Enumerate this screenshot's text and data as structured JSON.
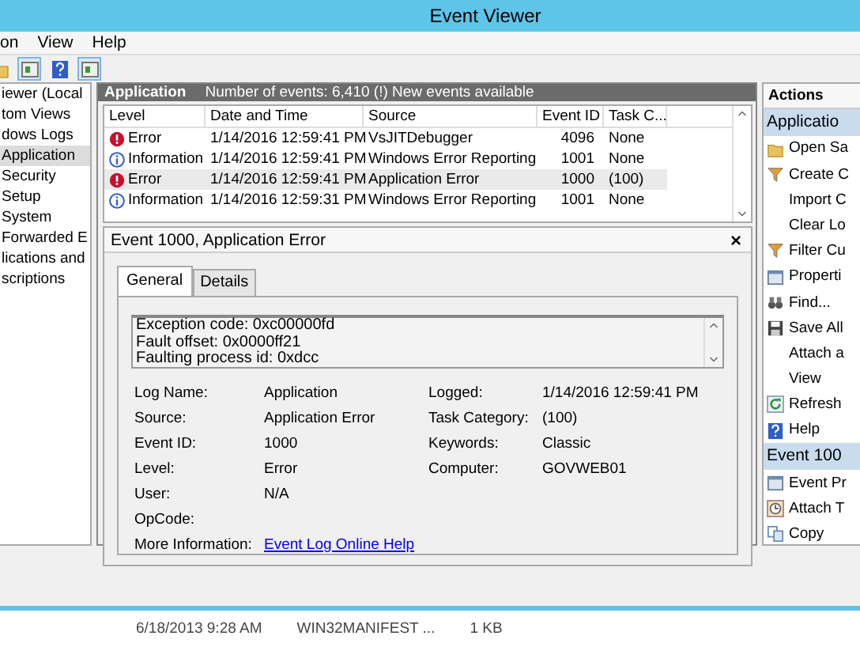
{
  "window": {
    "title": "Event Viewer"
  },
  "menu": [
    "on",
    "View",
    "Help"
  ],
  "toolbar": [
    {
      "kind": "folder",
      "selected": false
    },
    {
      "kind": "panel",
      "selected": true
    },
    {
      "kind": "help",
      "selected": false
    },
    {
      "kind": "panel",
      "selected": true
    }
  ],
  "tree": [
    {
      "label": "iewer (Local",
      "selected": false
    },
    {
      "label": "tom Views",
      "selected": false
    },
    {
      "label": "dows Logs",
      "selected": false
    },
    {
      "label": "Application",
      "selected": true
    },
    {
      "label": "Security",
      "selected": false
    },
    {
      "label": "Setup",
      "selected": false
    },
    {
      "label": "System",
      "selected": false
    },
    {
      "label": "Forwarded E",
      "selected": false
    },
    {
      "label": "lications and",
      "selected": false
    },
    {
      "label": "scriptions",
      "selected": false
    }
  ],
  "log_header": {
    "title": "Application",
    "summary": "Number of events: 6,410 (!) New events available"
  },
  "table": {
    "columns": [
      "Level",
      "Date and Time",
      "Source",
      "Event ID",
      "Task C..."
    ],
    "rows": [
      {
        "kind": "error",
        "selected": false,
        "cells": [
          "Error",
          "1/14/2016 12:59:41 PM",
          "VsJITDebugger",
          "4096",
          "None"
        ]
      },
      {
        "kind": "information",
        "selected": false,
        "cells": [
          "Information",
          "1/14/2016 12:59:41 PM",
          "Windows Error Reporting",
          "1001",
          "None"
        ]
      },
      {
        "kind": "error",
        "selected": true,
        "cells": [
          "Error",
          "1/14/2016 12:59:41 PM",
          "Application Error",
          "1000",
          "(100)"
        ]
      },
      {
        "kind": "information",
        "selected": false,
        "cells": [
          "Information",
          "1/14/2016 12:59:31 PM",
          "Windows Error Reporting",
          "1001",
          "None"
        ]
      }
    ]
  },
  "detail": {
    "title": "Event 1000, Application Error",
    "close": "×",
    "tabs": [
      {
        "label": "General",
        "selected": true
      },
      {
        "label": "Details",
        "selected": false
      }
    ],
    "description": [
      "Exception code: 0xc00000fd",
      "Fault offset: 0x0000ff21",
      "Faulting process id: 0xdcc"
    ],
    "fields_left": [
      {
        "label": "Log Name:",
        "value": "Application"
      },
      {
        "label": "Source:",
        "value": "Application Error"
      },
      {
        "label": "Event ID:",
        "value": "1000"
      },
      {
        "label": "Level:",
        "value": "Error"
      },
      {
        "label": "User:",
        "value": "N/A"
      },
      {
        "label": "OpCode:"
      }
    ],
    "fields_right": [
      {
        "label": "Logged:",
        "value": "1/14/2016 12:59:41 PM"
      },
      {
        "label": "Task Category:",
        "value": "(100)"
      },
      {
        "label": "Keywords:",
        "value": "Classic"
      },
      {
        "label": "Computer:",
        "value": "GOVWEB01"
      }
    ],
    "more_info": {
      "label": "More Information:",
      "link": "Event Log Online Help"
    }
  },
  "actions": {
    "title": "Actions",
    "sections": [
      {
        "title": "Applicatio",
        "items": [
          {
            "kind": "folder",
            "label": "Open Sa"
          },
          {
            "kind": "filter",
            "label": "Create C"
          },
          {
            "kind": "plain",
            "label": "Import C"
          },
          {
            "kind": "plain",
            "label": "Clear Lo"
          },
          {
            "kind": "filter",
            "label": "Filter Cu"
          },
          {
            "kind": "properties",
            "label": "Properti"
          },
          {
            "kind": "find",
            "label": "Find..."
          },
          {
            "kind": "save",
            "label": "Save All"
          },
          {
            "kind": "plain",
            "label": "Attach a"
          },
          {
            "kind": "plain",
            "label": "View"
          },
          {
            "kind": "refresh",
            "label": "Refresh"
          },
          {
            "kind": "help",
            "label": "Help"
          }
        ]
      },
      {
        "title": "Event 100",
        "items": [
          {
            "kind": "properties",
            "label": "Event Pr"
          },
          {
            "kind": "task",
            "label": "Attach T"
          },
          {
            "kind": "copy",
            "label": "Copy"
          }
        ]
      }
    ]
  },
  "background_window": {
    "cells": [
      "6/18/2013 9:28 AM",
      "WIN32MANIFEST ...",
      "1 KB"
    ]
  }
}
